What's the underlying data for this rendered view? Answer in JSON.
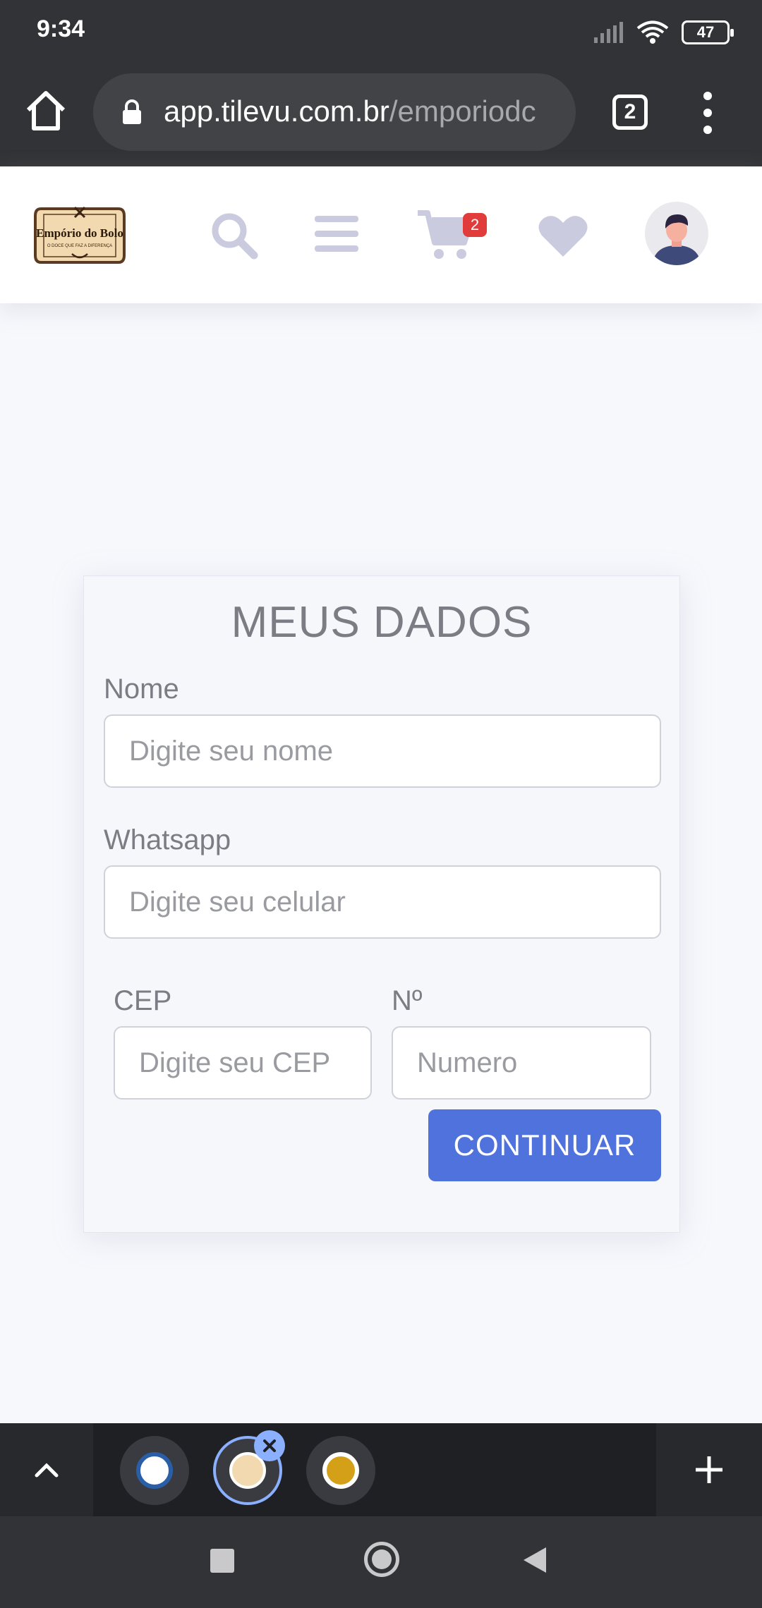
{
  "status_bar": {
    "time": "9:34",
    "battery": "47"
  },
  "browser": {
    "url_host": "app.tilevu.com.br",
    "url_path": "/emporiodc",
    "tab_count": "2"
  },
  "header": {
    "logo_text": "Empório do Bolo",
    "logo_subtext": "O DOCE QUE FAZ A DIFERENÇA",
    "cart_count": "2",
    "icons": [
      "search-icon",
      "menu-icon",
      "cart-icon",
      "heart-icon",
      "avatar"
    ],
    "accent_color": "#cbcbe0"
  },
  "form": {
    "title": "MEUS DADOS",
    "nome_label": "Nome",
    "nome_placeholder": "Digite seu nome",
    "whatsapp_label": "Whatsapp",
    "whatsapp_placeholder": "Digite seu celular",
    "cep_label": "CEP",
    "cep_placeholder": "Digite seu CEP",
    "numero_label": "Nº",
    "numero_placeholder": "Numero",
    "continue_label": "CONTINUAR",
    "button_color": "#4f72dc"
  },
  "tab_strip": {
    "tabs": [
      "tab-1",
      "tab-2",
      "tab-3"
    ],
    "active_index": 1
  }
}
